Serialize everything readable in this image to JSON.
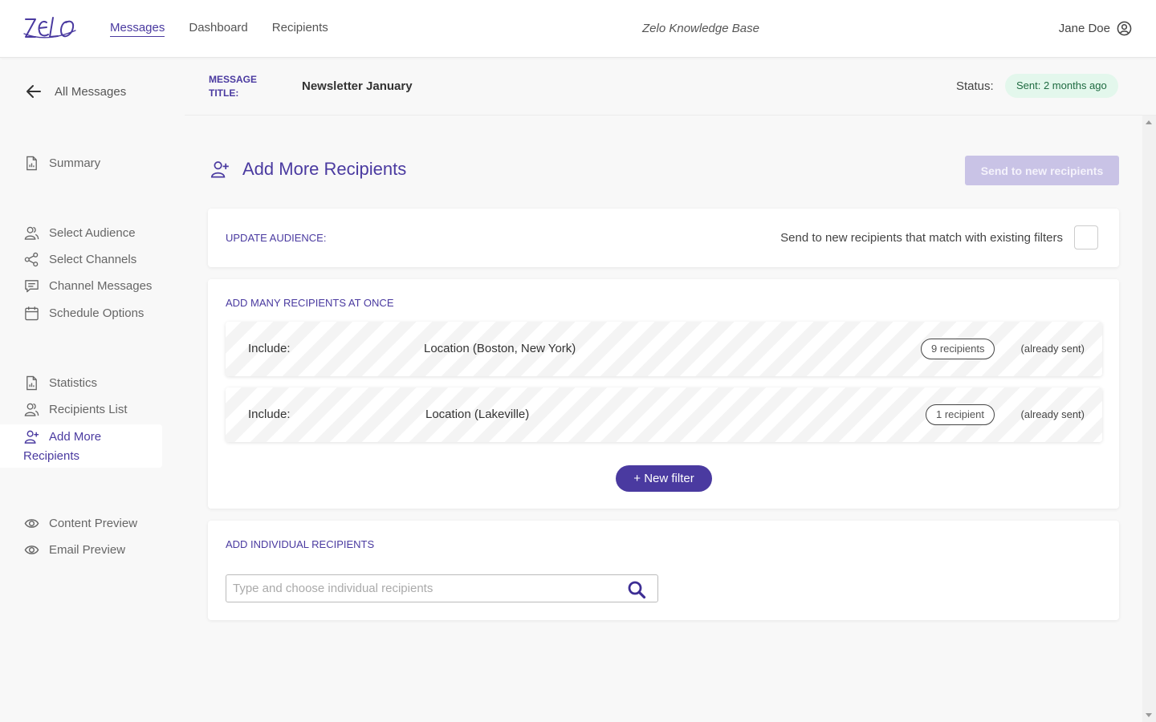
{
  "brand": {
    "logo_text": "ZELO",
    "accent": "#4a3aa0"
  },
  "nav": {
    "items": [
      {
        "label": "Messages",
        "active": true
      },
      {
        "label": "Dashboard",
        "active": false
      },
      {
        "label": "Recipients",
        "active": false
      }
    ]
  },
  "header": {
    "knowledge_base": "Zelo Knowledge Base",
    "user_name": "Jane Doe"
  },
  "sidebar": {
    "back_label": "All Messages",
    "summary": "Summary",
    "select_audience": "Select Audience",
    "select_channels": "Select Channels",
    "channel_messages": "Channel Messages",
    "schedule_options": "Schedule Options",
    "statistics": "Statistics",
    "recipients_list": "Recipients List",
    "add_more_line1": "Add More",
    "add_more_line2": "Recipients",
    "content_preview": "Content Preview",
    "email_preview": "Email Preview"
  },
  "message": {
    "title_label_1": "MESSAGE",
    "title_label_2": "TITLE:",
    "title": "Newsletter January",
    "status_label": "Status:",
    "status": "Sent: 2 months ago",
    "status_color": "#e3f7ec"
  },
  "page": {
    "title": "Add More Recipients",
    "send_button": "Send to new recipients"
  },
  "update_audience": {
    "heading": "UPDATE AUDIENCE:",
    "match_text": "Send to new recipients that match with existing filters",
    "checked": false
  },
  "many": {
    "heading": "ADD MANY RECIPIENTS AT ONCE",
    "filters": [
      {
        "include": "Include:",
        "location": "Location (Boston, New York)",
        "count": "9 recipients",
        "note": "(already sent)"
      },
      {
        "include": "Include:",
        "location": "Location (Lakeville)",
        "count": "1 recipient",
        "note": "(already sent)"
      }
    ],
    "new_filter": "+ New filter"
  },
  "individual": {
    "heading": "ADD INDIVIDUAL RECIPIENTS",
    "placeholder": "Type and choose individual recipients",
    "value": ""
  }
}
